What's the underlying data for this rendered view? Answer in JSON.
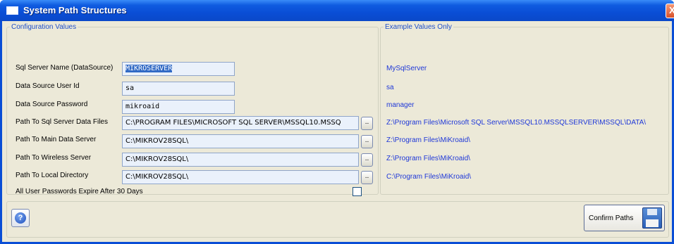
{
  "window": {
    "title": "System Path Structures",
    "close_glyph": "X"
  },
  "config": {
    "legend": "Configuration Values",
    "fields": [
      {
        "label": "Sql Server Name (DataSource)",
        "value": "MIKROSERVER"
      },
      {
        "label": "Data Source User Id",
        "value": "sa"
      },
      {
        "label": "Data Source Password",
        "value": "mikroaid"
      },
      {
        "label": "Path To Sql Server Data Files",
        "value": "C:\\PROGRAM FILES\\MICROSOFT SQL SERVER\\MSSQL10.MSSQ",
        "browse": ".."
      },
      {
        "label": "Path To Main Data Server",
        "value": "C:\\MIKROV28SQL\\",
        "browse": ".."
      },
      {
        "label": "Path To Wireless Server",
        "value": "C:\\MIKROV28SQL\\",
        "browse": ".."
      },
      {
        "label": "Path To Local Directory",
        "value": "C:\\MIKROV28SQL\\",
        "browse": ".."
      }
    ],
    "expire_label": "All User Passwords Expire After 30 Days",
    "expire_checked": false
  },
  "examples": {
    "legend": "Example Values Only",
    "values": [
      "MySqlServer",
      "sa",
      "manager",
      "Z:\\Program Files\\Microsoft SQL Server\\MSSQL10.MSSQLSERVER\\MSSQL\\DATA\\",
      "Z:\\Program Files\\MiKroaid\\",
      "Z:\\Program Files\\MiKroaid\\",
      "C:\\Program Files\\MiKroaid\\"
    ]
  },
  "footer": {
    "help_glyph": "?",
    "confirm_label": "Confirm Paths",
    "confirm_icon": "floppy-disk-icon"
  },
  "colors": {
    "title_bar": "#0a4ed6",
    "dialog_bg": "#ece9d8",
    "legend_text": "#1f4fc8",
    "example_text": "#1f38d8",
    "input_bg": "#eaf1fb"
  }
}
